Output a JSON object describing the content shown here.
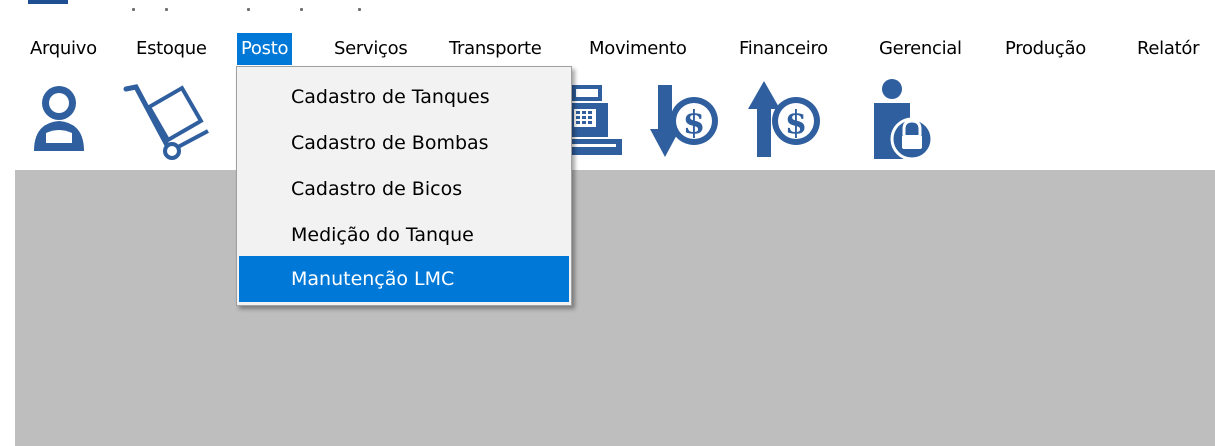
{
  "menubar": {
    "items": [
      {
        "label": "Arquivo"
      },
      {
        "label": "Estoque"
      },
      {
        "label": "Posto"
      },
      {
        "label": "Serviços"
      },
      {
        "label": "Transporte"
      },
      {
        "label": "Movimento"
      },
      {
        "label": "Financeiro"
      },
      {
        "label": "Gerencial"
      },
      {
        "label": "Produção"
      },
      {
        "label": "Relatór"
      }
    ],
    "active_item": "Posto"
  },
  "dropdown": {
    "items": [
      {
        "label": "Cadastro de Tanques"
      },
      {
        "label": "Cadastro de Bombas"
      },
      {
        "label": "Cadastro de Bicos"
      },
      {
        "label": "Medição do Tanque"
      },
      {
        "label": "Manutenção LMC"
      }
    ],
    "highlighted_item": "Manutenção LMC"
  },
  "toolbar": {
    "icons": [
      "user-icon",
      "hand-truck-icon",
      "cash-register-icon",
      "money-in-icon",
      "money-out-icon",
      "user-lock-icon"
    ]
  },
  "colors": {
    "accent": "#0078d7",
    "icon_blue": "#2f5f9e",
    "workspace": "#bebebe"
  }
}
